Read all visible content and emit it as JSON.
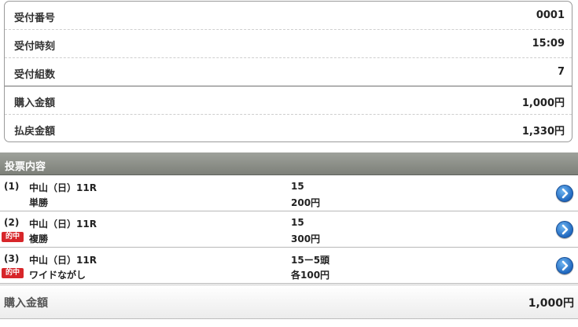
{
  "summary": {
    "rows": [
      {
        "label": "受付番号",
        "value": "0001"
      },
      {
        "label": "受付時刻",
        "value": "15:09"
      },
      {
        "label": "受付組数",
        "value": "7"
      },
      {
        "label": "購入金額",
        "value": "1,000円"
      },
      {
        "label": "払戻金額",
        "value": "1,330円"
      }
    ]
  },
  "section": {
    "title": "投票内容"
  },
  "bets": [
    {
      "number": "(1)",
      "race": "中山（日）11R",
      "type": "単勝",
      "combination": "15",
      "amount": "200円",
      "badge": ""
    },
    {
      "number": "(2)",
      "race": "中山（日）11R",
      "type": "複勝",
      "combination": "15",
      "amount": "300円",
      "badge": "的中"
    },
    {
      "number": "(3)",
      "race": "中山（日）11R",
      "type": "ワイドながし",
      "combination": "15ー5頭",
      "amount": "各100円",
      "badge": "的中"
    }
  ],
  "total": {
    "label": "購入金額",
    "value": "1,000円"
  },
  "icons": {
    "detail": "chevron-right-circle-icon"
  },
  "colors": {
    "badge": "#d7262a",
    "header": "#8a8d87",
    "arrow": "#2a72c6"
  }
}
